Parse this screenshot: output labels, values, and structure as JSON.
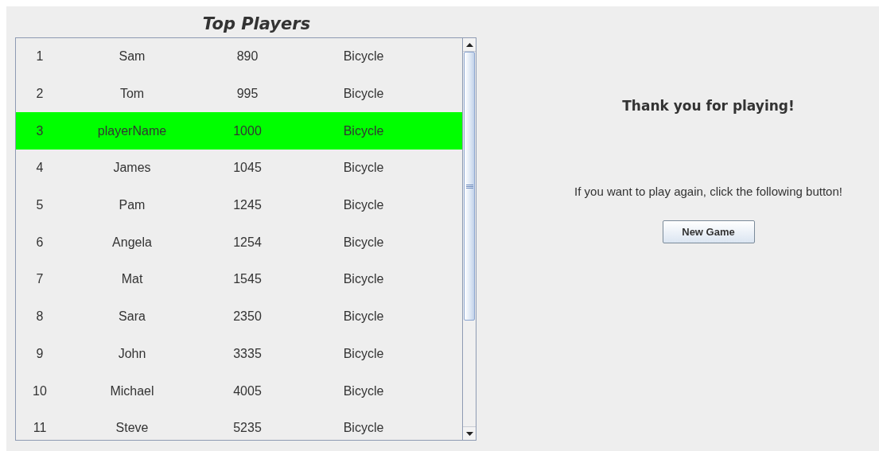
{
  "leaderboard": {
    "title": "Top Players",
    "rows": [
      {
        "cells": [
          "1",
          "Sam",
          "890",
          "Bicycle"
        ],
        "selected": false
      },
      {
        "cells": [
          "2",
          "Tom",
          "995",
          "Bicycle"
        ],
        "selected": false
      },
      {
        "cells": [
          "3",
          "playerName",
          "1000",
          "Bicycle"
        ],
        "selected": true
      },
      {
        "cells": [
          "4",
          "James",
          "1045",
          "Bicycle"
        ],
        "selected": false
      },
      {
        "cells": [
          "5",
          "Pam",
          "1245",
          "Bicycle"
        ],
        "selected": false
      },
      {
        "cells": [
          "6",
          "Angela",
          "1254",
          "Bicycle"
        ],
        "selected": false
      },
      {
        "cells": [
          "7",
          "Mat",
          "1545",
          "Bicycle"
        ],
        "selected": false
      },
      {
        "cells": [
          "8",
          "Sara",
          "2350",
          "Bicycle"
        ],
        "selected": false
      },
      {
        "cells": [
          "9",
          "John",
          "3335",
          "Bicycle"
        ],
        "selected": false
      },
      {
        "cells": [
          "10",
          "Michael",
          "4005",
          "Bicycle"
        ],
        "selected": false
      },
      {
        "cells": [
          "11",
          "Steve",
          "5235",
          "Bicycle"
        ],
        "selected": false
      }
    ]
  },
  "end_panel": {
    "heading": "Thank you for playing!",
    "message": "If you want to play again, click the following button!",
    "button": "New Game"
  }
}
